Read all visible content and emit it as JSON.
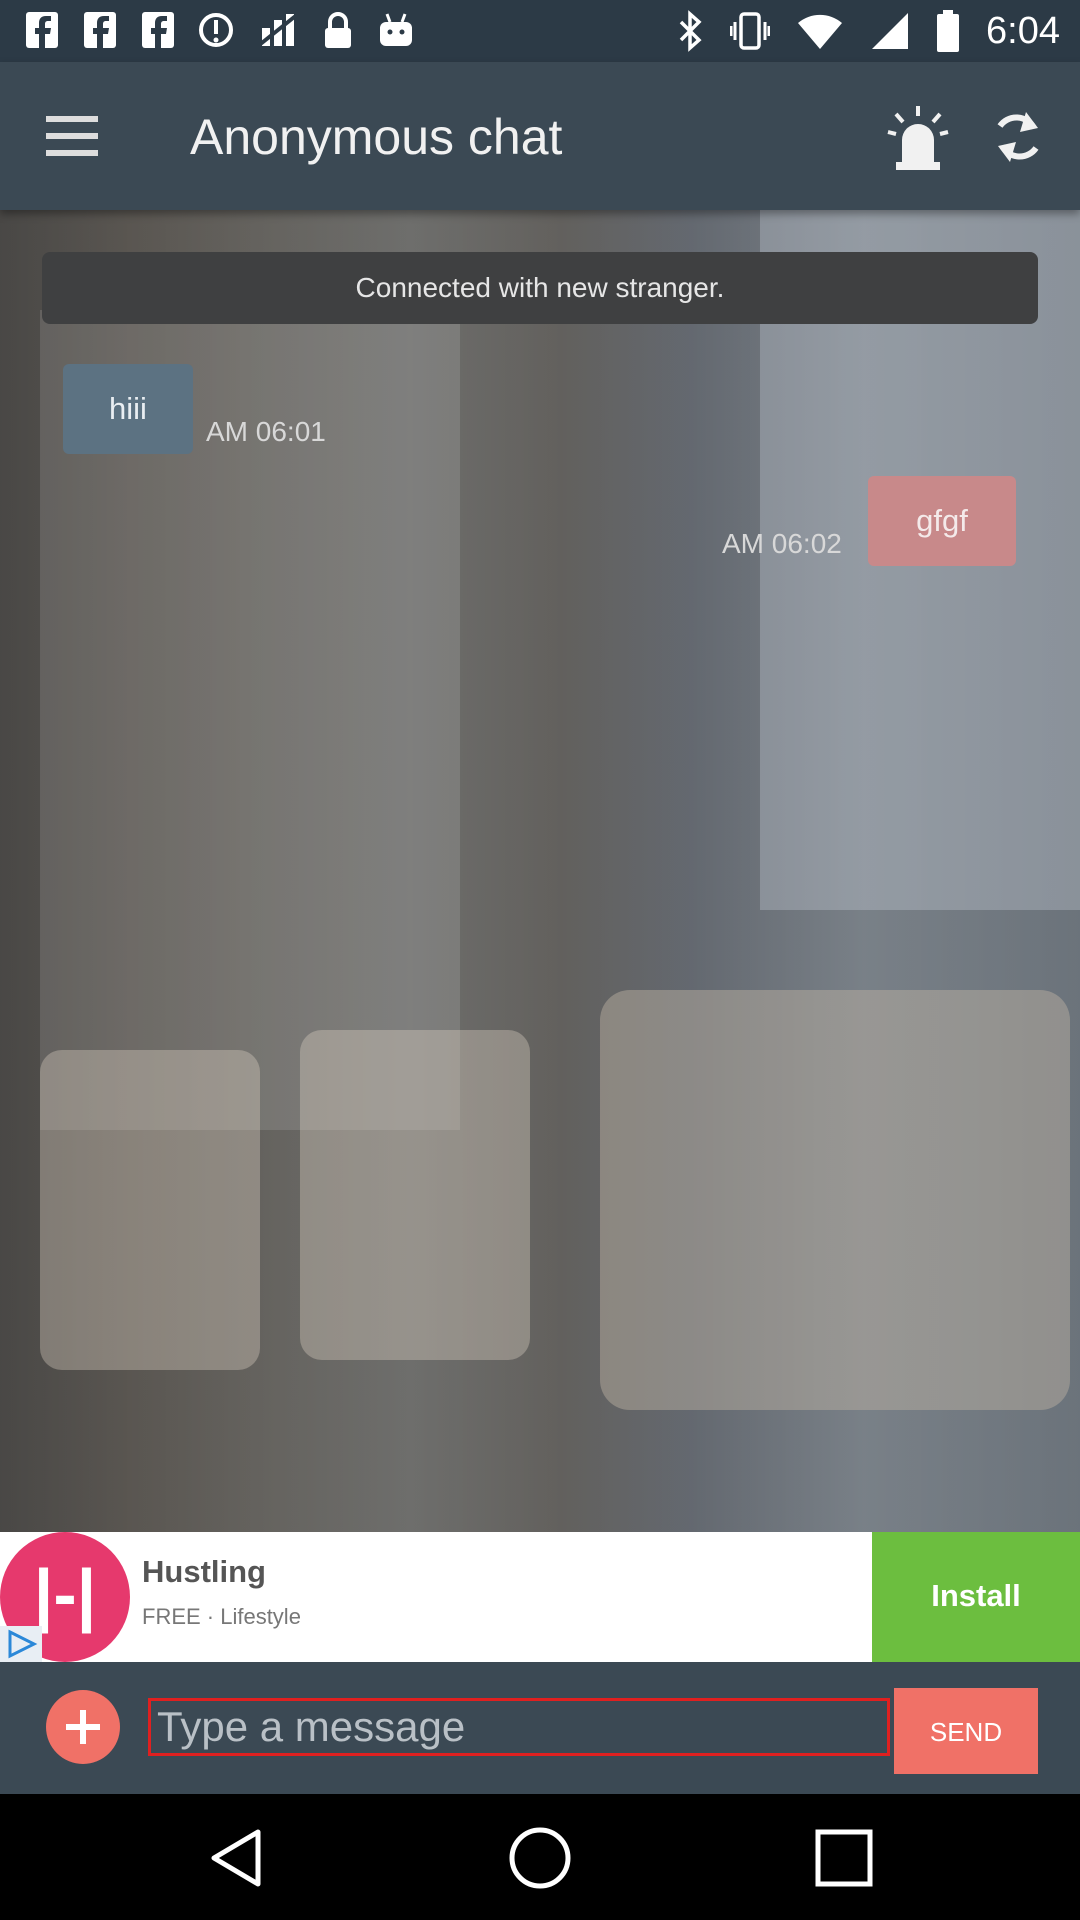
{
  "status_bar": {
    "time": "6:04"
  },
  "app_bar": {
    "title": "Anonymous chat"
  },
  "chat": {
    "system_message": "Connected with new stranger.",
    "messages": [
      {
        "direction": "incoming",
        "text": "hiii",
        "time": "AM 06:01"
      },
      {
        "direction": "outgoing",
        "text": "gfgf",
        "time": "AM 06:02"
      }
    ]
  },
  "ad": {
    "app_name": "Hustling",
    "subtitle": "FREE · Lifestyle",
    "logo_text": "|-|",
    "install_label": "Install"
  },
  "composer": {
    "placeholder": "Type a message",
    "send_label": "SEND"
  },
  "colors": {
    "app_bar": "#3b4954",
    "accent": "#f07167",
    "incoming_bubble": "#5c7282",
    "outgoing_bubble": "#c8898a",
    "install": "#6cbe3f"
  }
}
